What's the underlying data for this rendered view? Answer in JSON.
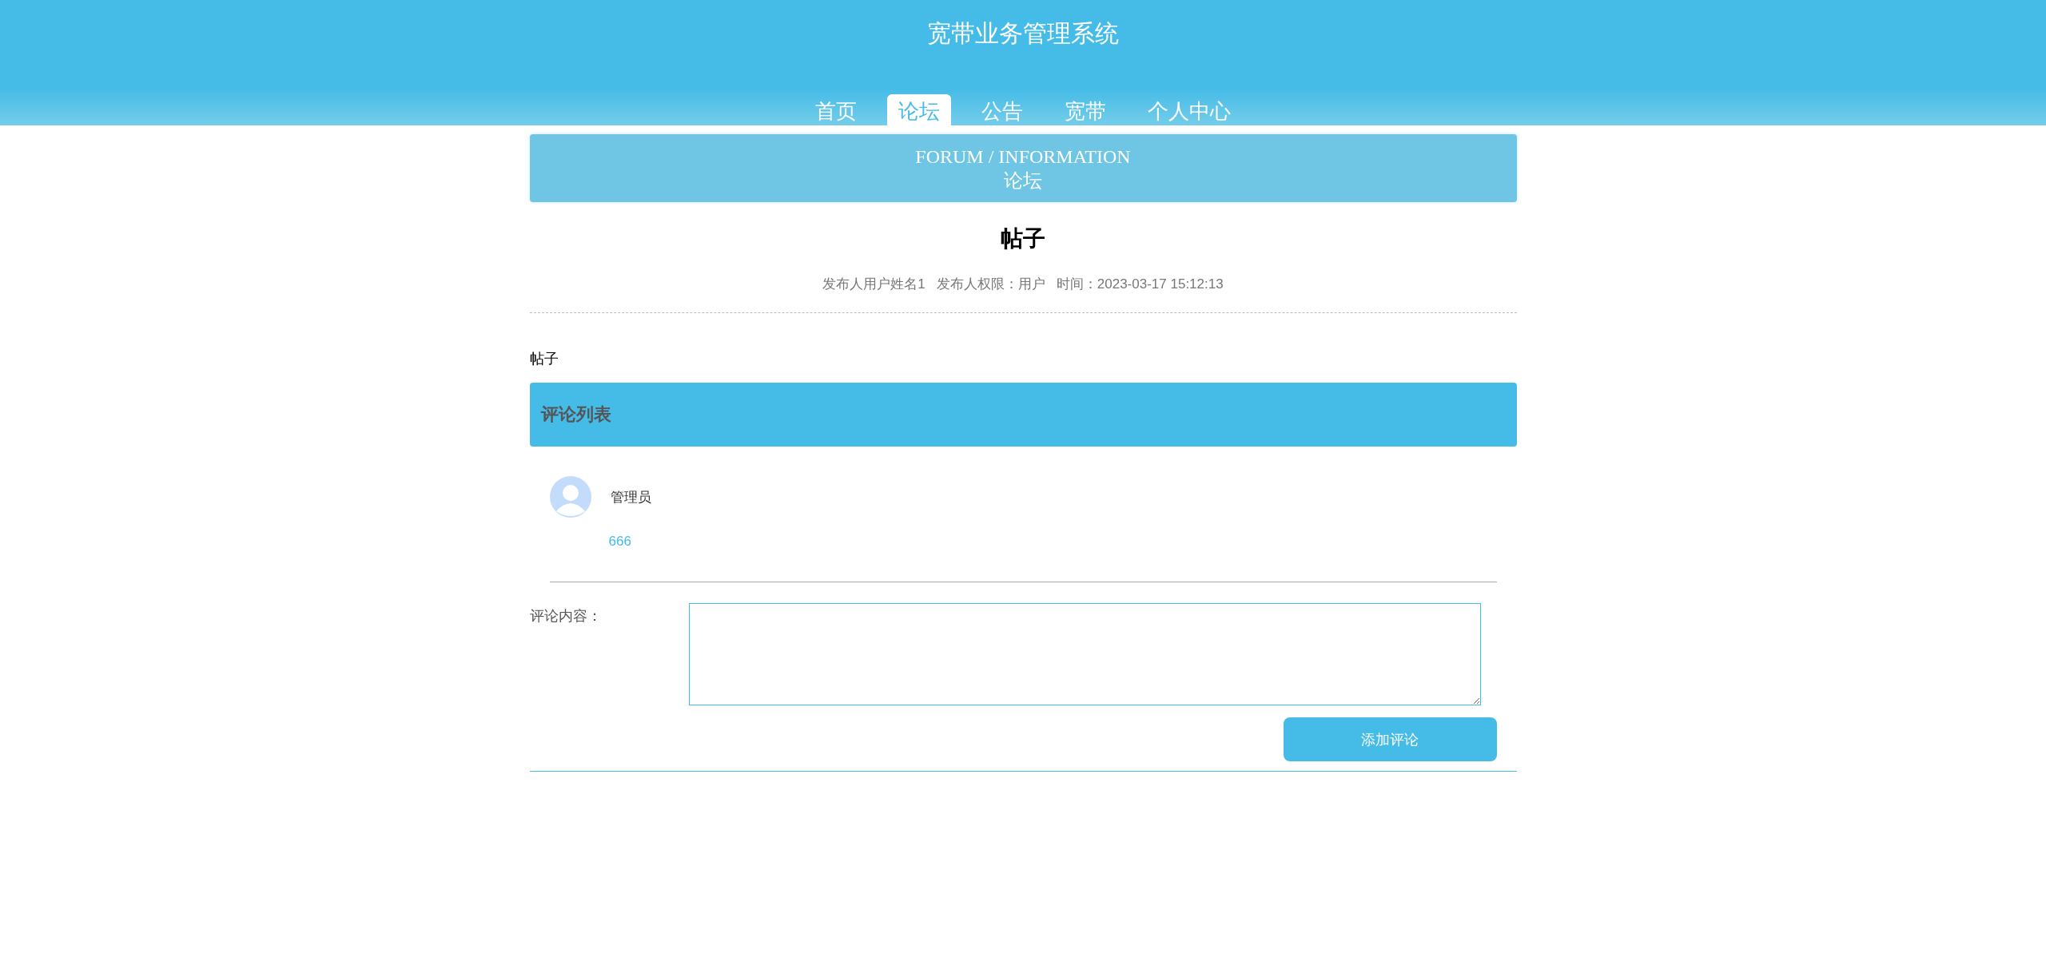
{
  "header": {
    "title": "宽带业务管理系统",
    "nav": [
      {
        "label": "首页",
        "selected": false
      },
      {
        "label": "论坛",
        "selected": true
      },
      {
        "label": "公告",
        "selected": false
      },
      {
        "label": "宽带",
        "selected": false
      },
      {
        "label": "个人中心",
        "selected": false
      }
    ]
  },
  "banner": {
    "english": "FORUM / INFORMATION",
    "chinese": "论坛"
  },
  "post": {
    "title": "帖子",
    "meta": [
      "发布人用户姓名1",
      "发布人权限：用户",
      "时间：2023-03-17 15:12:13"
    ],
    "content": "帖子"
  },
  "comments": {
    "heading": "评论列表",
    "items": [
      {
        "author": "管理员",
        "text": "666"
      }
    ]
  },
  "form": {
    "label": "评论内容：",
    "button": "添加评论"
  }
}
